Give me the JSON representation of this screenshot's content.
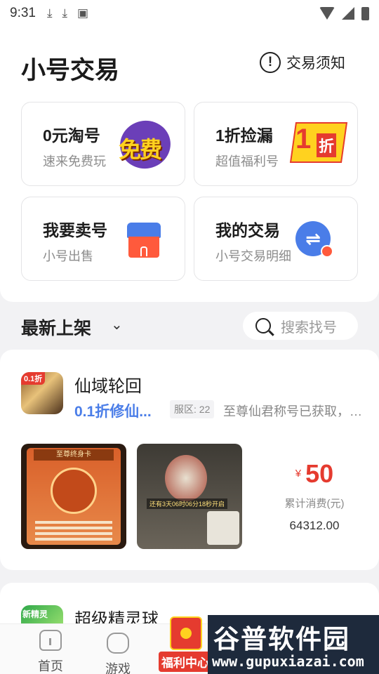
{
  "status_bar": {
    "time": "9:31"
  },
  "header": {
    "title": "小号交易",
    "notice_label": "交易须知"
  },
  "cards": [
    {
      "title": "0元淘号",
      "subtitle": "速来免费玩",
      "badge": "免费",
      "icon": "free-badge"
    },
    {
      "title": "1折捡漏",
      "subtitle": "超值福利号",
      "badge": "1折",
      "icon": "discount-badge"
    },
    {
      "title": "我要卖号",
      "subtitle": "小号出售",
      "icon": "shop-icon"
    },
    {
      "title": "我的交易",
      "subtitle": "小号交易明细",
      "icon": "swap-icon"
    }
  ],
  "filter": {
    "sort_label": "最新上架",
    "search_placeholder": "搜索找号"
  },
  "listings": [
    {
      "name": "仙域轮回",
      "icon_tag": "0.1折",
      "subtitle": "0.1折修仙...",
      "server": "服区: 22",
      "description": "至尊仙君称号已获取，没...",
      "screenshot1_caption": "至尊终身卡",
      "screenshot2_caption": "还有3天06时06分18秒开启",
      "currency": "¥",
      "price": "50",
      "spend_label": "累计消费(元)",
      "spend_value": "64312.00"
    },
    {
      "name": "超级精灵球",
      "icon_tag": "新精灵"
    }
  ],
  "tabbar": {
    "items": [
      {
        "label": "首页",
        "icon": "home-icon"
      },
      {
        "label": "游戏",
        "icon": "gamepad-icon"
      }
    ],
    "welfare_label": "福利中心"
  },
  "watermark": {
    "cn": "谷普软件园",
    "url": "www.gupuxiazai.com"
  },
  "colors": {
    "accent_blue": "#4a7de8",
    "price_red": "#e53b2f",
    "background": "#f2f2f4"
  }
}
